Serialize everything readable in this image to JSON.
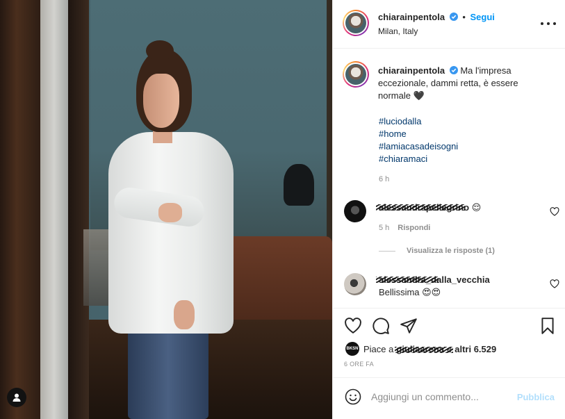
{
  "post": {
    "author": "chiarainpentola",
    "follow_label": "Segui",
    "separator": "•",
    "location": "Milan, Italy",
    "caption": "Ma l'impresa eccezionale, dammi retta, è essere normale 🖤",
    "hashtags": [
      "#luciodalla",
      "#home",
      "#lamiacasadeisogni",
      "#chiaramaci"
    ],
    "caption_time": "6 h"
  },
  "comments": [
    {
      "user": "alessandrapellegrino",
      "text": "😌",
      "time": "5 h",
      "reply_label": "Rispondi"
    },
    {
      "user": "alessandra_dalla_vecchia",
      "text": "Bellissima 😍😍"
    }
  ],
  "view_replies": "Visualizza le risposte (1)",
  "likes": {
    "prefix": "Piace a",
    "name": "giuliaarena",
    "suffix": "e",
    "count_text": "altri 6.529",
    "avatar_text": "BKSN"
  },
  "post_age": "6 ORE FA",
  "add_comment": {
    "placeholder": "Aggiungi un commento...",
    "publish_label": "Pubblica"
  },
  "icons": {
    "like": "heart-icon",
    "comment": "comment-icon",
    "share": "paper-plane-icon",
    "save": "bookmark-icon",
    "more": "more-dots-icon",
    "emoji": "emoji-icon",
    "tag": "user-tag-icon",
    "verified": "verified-badge-icon"
  },
  "colors": {
    "accent": "#0095f6",
    "hashtag": "#00376b",
    "muted": "#8e8e8e",
    "publish_disabled": "#b2dffc"
  }
}
